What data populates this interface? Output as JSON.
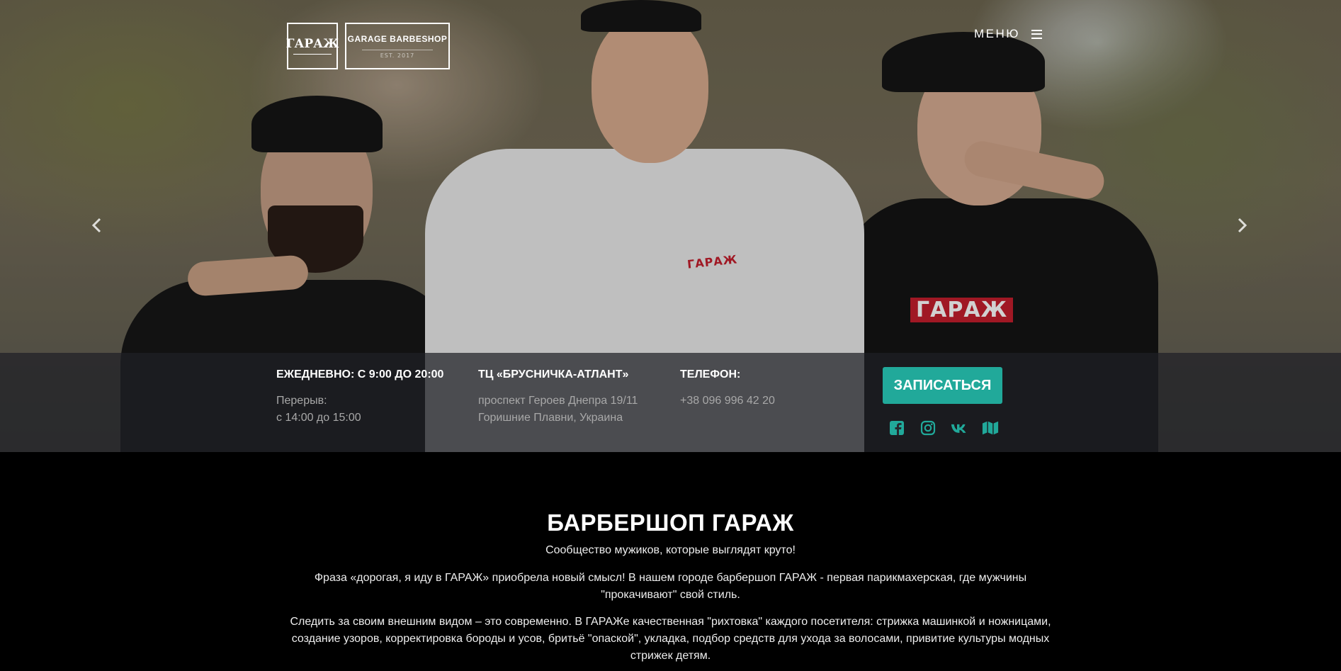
{
  "header": {
    "logo_badge": "ГАРАЖ",
    "logo_name": "GARAGE BARBESHOP",
    "logo_est": "EST. 2017",
    "menu_label": "МЕНЮ"
  },
  "hero": {
    "prev_icon": "chevron-left-icon",
    "next_icon": "chevron-right-icon",
    "shirt_logo": "ГАРАЖ"
  },
  "info": {
    "hours": {
      "title": "ЕЖЕДНЕВНО: С 9:00 ДО 20:00",
      "line1": "Перерыв:",
      "line2": "с 14:00 до 15:00"
    },
    "location": {
      "title": "ТЦ «БРУСНИЧКА-АТЛАНТ»",
      "line1": "проспект Героев Днепра 19/11",
      "line2": "Горишние Плавни, Украина"
    },
    "phone": {
      "title": "ТЕЛЕФОН:",
      "line1": "+38 096 996 42 20"
    },
    "book_label": "ЗАПИСАТЬСЯ",
    "socials": [
      "facebook-icon",
      "instagram-icon",
      "vk-icon",
      "map-icon"
    ],
    "accent": "#21a99a"
  },
  "about": {
    "title": "БАРБЕРШОП ГАРАЖ",
    "subtitle": "Сообщество мужиков, которые выглядят круто!",
    "p1": "Фраза «дорогая, я иду в ГАРАЖ» приобрела новый смысл! В нашем городе барбершоп ГАРАЖ - первая парикмахерская, где мужчины \"прокачивают\" свой стиль.",
    "p2": "Следить за своим внешним видом – это современно. В ГАРАЖе качественная \"рихтовка\" каждого посетителя: стрижка машинкой и ножницами, создание узоров, корректировка бороды и усов, бритьё \"опаской\", укладка, подбор средств для ухода за волосами, привитие культуры модных стрижек детям."
  }
}
